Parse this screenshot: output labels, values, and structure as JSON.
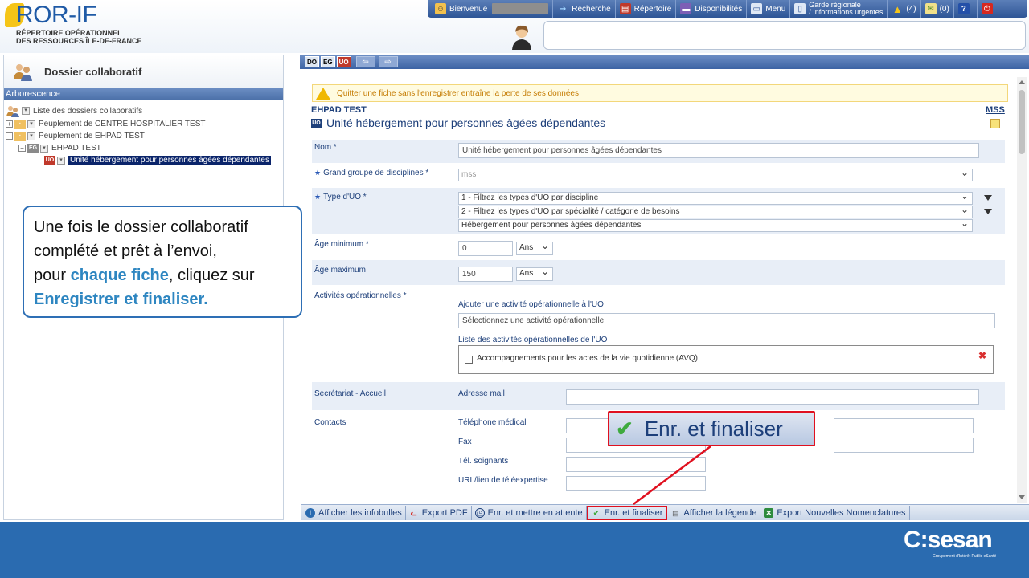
{
  "header": {
    "logo_title": "ROR-IF",
    "logo_line1": "RÉPERTOIRE OPÉRATIONNEL",
    "logo_line2": "DES RESSOURCES ÎLE-DE-FRANCE",
    "nav": {
      "bienvenue": "Bienvenue",
      "recherche": "Recherche",
      "repertoire": "Répertoire",
      "disponibilites": "Disponibilités",
      "menu": "Menu",
      "garde_line1": "Garde régionale",
      "garde_line2": "/ Informations urgentes",
      "alerts_count": "(4)",
      "messages_count": "(0)",
      "help": "?"
    }
  },
  "left_panel": {
    "title": "Dossier collaboratif",
    "section": "Arborescence",
    "tree": {
      "root": "Liste des dossiers collaboratifs",
      "item1": "Peuplement de CENTRE HOSPITALIER TEST",
      "item2": "Peuplement de EHPAD TEST",
      "item2_child": "EHPAD TEST",
      "item2_grandchild": "Unité hébergement pour personnes âgées dépendantes",
      "badge_eg": "EG",
      "badge_uo": "UO"
    }
  },
  "callout": {
    "line1": "Une fois le dossier collaboratif",
    "line2": "complété et prêt à l’envoi,",
    "line3_pre": "pour ",
    "line3_hl": "chaque fiche",
    "line3_post": ", cliquez sur",
    "line4_hl": "Enregistrer et finaliser."
  },
  "right_toolbar": {
    "badge_do": "DO",
    "badge_eg": "EG",
    "badge_uo": "UO"
  },
  "content": {
    "warning": "Quitter une fiche sans l'enregistrer entraîne la perte de ses données",
    "org_name": "EHPAD TEST",
    "mss_link": "MSS",
    "uo_badge": "UO",
    "unit_title": "Unité hébergement pour personnes âgées dépendantes"
  },
  "form": {
    "nom_label": "Nom *",
    "nom_value": "Unité hébergement pour personnes âgées dépendantes",
    "grand_groupe_label": "Grand groupe de disciplines *",
    "grand_groupe_value": "mss",
    "type_uo_label": "Type d'UO *",
    "type_uo_select1": "1 - Filtrez les types d'UO par discipline",
    "type_uo_select2": "2 - Filtrez les types d'UO par spécialité / catégorie de besoins",
    "type_uo_select3": "Hébergement pour personnes âgées dépendantes",
    "age_min_label": "Âge minimum *",
    "age_min_value": "0",
    "age_min_unit": "Ans",
    "age_max_label": "Âge maximum",
    "age_max_value": "150",
    "age_max_unit": "Ans",
    "activites_label": "Activités opérationnelles *",
    "ajouter_activite": "Ajouter une activité opérationnelle à l'UO",
    "select_activite_placeholder": "Sélectionnez une activité opérationnelle",
    "liste_activites": "Liste des activités opérationnelles de l'UO",
    "activite_item": "Accompagnements pour les actes de la vie quotidienne (AVQ)",
    "secretariat_label": "Secrétariat - Accueil",
    "adresse_mail": "Adresse mail",
    "contacts_label": "Contacts",
    "tel_medical": "Téléphone médical",
    "fax": "Fax",
    "tel_soignants": "Tél. soignants",
    "url_teleexpertise": "URL/lien de téléexpertise"
  },
  "bottom_bar": {
    "infobulles": "Afficher les infobulles",
    "export_pdf": "Export PDF",
    "attente": "Enr. et mettre en attente",
    "finaliser": "Enr. et finaliser",
    "legende": "Afficher la légende",
    "nomenclatures": "Export Nouvelles Nomenclatures"
  },
  "zoom": {
    "label": "Enr. et finaliser"
  },
  "footer": {
    "brand": "C:sesan",
    "tagline": "Groupement d'Intérêt Public eSanté"
  },
  "colors": {
    "accent": "#2a6bb0",
    "highlight": "#e0101f",
    "link": "#1d3f7a"
  }
}
